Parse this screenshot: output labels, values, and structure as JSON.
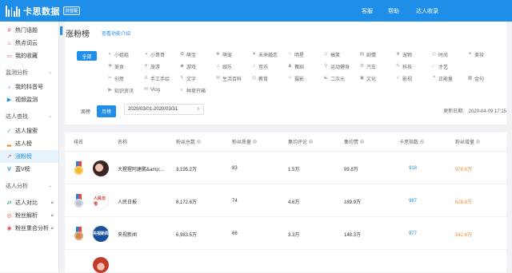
{
  "header": {
    "logo_text": "卡思数据",
    "logo_tag": "抖音版",
    "nav": [
      "客服",
      "帮助",
      "达人收录"
    ]
  },
  "sidebar": {
    "items": [
      {
        "label": "热门话题",
        "icon": "hash-icon",
        "glyph": "#"
      },
      {
        "label": "热点词云",
        "icon": "fire-icon",
        "glyph": "♨"
      },
      {
        "label": "我的收藏",
        "icon": "folder-icon",
        "glyph": "▭"
      }
    ],
    "section_monitor": "监测分析",
    "monitor_items": [
      {
        "label": "我的抖音号",
        "icon": "tiktok-icon",
        "glyph": "♪"
      },
      {
        "label": "视频监测",
        "icon": "video-icon",
        "glyph": "▶"
      }
    ],
    "section_search": "达人查找",
    "search_items": [
      {
        "label": "达人搜索",
        "icon": "search-icon",
        "glyph": "✓",
        "active": false
      },
      {
        "label": "达人榜",
        "icon": "chart-icon",
        "glyph": "▂",
        "active": false
      },
      {
        "label": "涨粉榜",
        "icon": "trend-icon",
        "glyph": "↗",
        "active": true
      },
      {
        "label": "蓝V榜",
        "icon": "v-icon",
        "glyph": "V",
        "active": false
      }
    ],
    "section_analysis": "达人分析",
    "analysis_items": [
      {
        "label": "达人对比",
        "icon": "compare-icon",
        "glyph": "⇄"
      },
      {
        "label": "粉丝解析",
        "icon": "fans-icon",
        "glyph": "◎"
      },
      {
        "label": "粉丝重合分析",
        "icon": "overlap-icon",
        "glyph": "◉"
      }
    ]
  },
  "page": {
    "title": "涨粉榜",
    "func_link": "查看功能介绍",
    "all_label": "全部",
    "categories_row1": [
      "小姐姐",
      "小哥哥",
      "萌宝",
      "萌宠",
      "未来婚恋",
      "明星",
      "搞笑",
      "剧情",
      "宠物",
      "时尚",
      "美妆"
    ],
    "categories_row2": [
      "美食",
      "旅游",
      "游戏",
      "娱乐",
      "音乐",
      "舞蹈",
      "运动健身",
      "汽车",
      "科技",
      "才艺"
    ],
    "categories_row3": [
      "创意",
      "手工手绘",
      "文字",
      "生活百科",
      "教育",
      "摄影",
      "二次元",
      "文化",
      "影视",
      "正能量",
      "金句"
    ],
    "categories_row4": [
      "知识资讯",
      "Vlog",
      "种草开箱"
    ],
    "tab_week": "周榜",
    "tab_month": "月榜",
    "date_range": "2020/03/01-2020/03/31",
    "update_label": "更新日期:",
    "update_value": "2020-04-09 17:15"
  },
  "table": {
    "headers": [
      "排名",
      "名称",
      "粉丝总数",
      "粉丝质量",
      "集均评论",
      "集均赞",
      "卡思指数",
      "粉丝增量"
    ],
    "rows": [
      {
        "name": "大猩猩阿建鹏&amp;...",
        "fans": "3,195.2万",
        "quality": "83",
        "comments": "1.5万",
        "likes": "99.8万",
        "index": "918",
        "increase": "978.6万",
        "medal": "gold",
        "avatar": "avatar-1"
      },
      {
        "name": "人民日报",
        "fans": "8,172.6万",
        "quality": "74",
        "comments": "4.6万",
        "likes": "189.9万",
        "index": "987",
        "increase": "626.8万",
        "medal": "silver",
        "avatar": "avatar-2"
      },
      {
        "name": "央视新闻",
        "fans": "6,983.5万",
        "quality": "66",
        "comments": "3.3万",
        "likes": "148.3万",
        "index": "977",
        "increase": "542.6万",
        "medal": "bronze",
        "avatar": "avatar-3",
        "avatar_text": "央视新闻"
      }
    ]
  },
  "colors": {
    "brand": "#1e8ee8",
    "orange": "#f08c2c",
    "gold": "#f3b72b",
    "silver": "#b9c3cf",
    "bronze": "#c9874f"
  }
}
